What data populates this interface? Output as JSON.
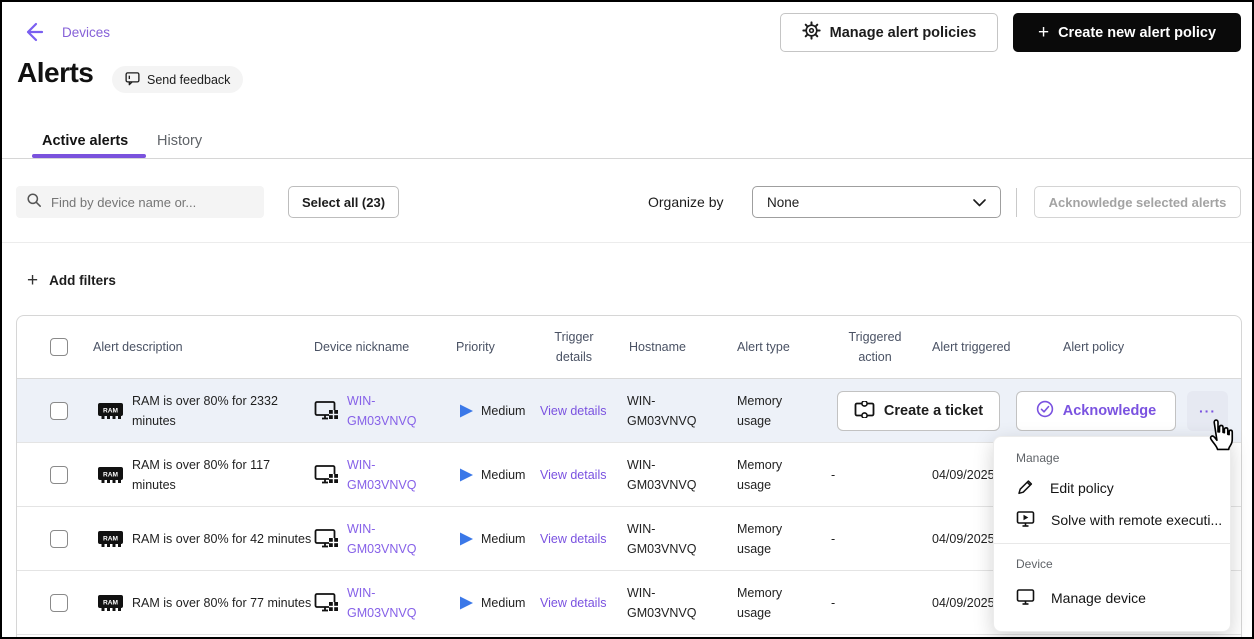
{
  "topbar": {
    "breadcrumb": "Devices",
    "manage_alert_policies": "Manage alert policies",
    "create_new_alert_policy": "Create new alert policy",
    "plus_glyph": "+"
  },
  "page": {
    "title": "Alerts",
    "send_feedback": "Send feedback"
  },
  "tabs": {
    "active_alerts": "Active alerts",
    "history": "History"
  },
  "toolbar": {
    "search_placeholder": "Find by device name or...",
    "select_all": "Select all (23)",
    "organize_by_label": "Organize by",
    "organize_by_value": "None",
    "acknowledge_selected": "Acknowledge selected alerts"
  },
  "filters": {
    "add_filters": "Add filters",
    "plus_glyph": "+"
  },
  "table": {
    "headers": {
      "alert_description": "Alert description",
      "device_nickname": "Device nickname",
      "priority": "Priority",
      "trigger_details": "Trigger details",
      "hostname": "Hostname",
      "alert_type": "Alert type",
      "triggered_action": "Triggered action",
      "alert_triggered": "Alert triggered",
      "alert_policy": "Alert policy"
    },
    "rows": [
      {
        "description": "RAM is over 80% for 2332 minutes",
        "nickname": "WIN-GM03VNVQ",
        "priority": "Medium",
        "trigger_details": "View details",
        "hostname": "WIN-GM03VNVQ",
        "alert_type": "Memory usage",
        "create_ticket": "Create a ticket",
        "acknowledge": "Acknowledge",
        "more_glyph": "···"
      },
      {
        "description": "RAM is over 80% for 117 minutes",
        "nickname": "WIN-GM03VNVQ",
        "priority": "Medium",
        "trigger_details": "View details",
        "hostname": "WIN-GM03VNVQ",
        "alert_type": "Memory usage",
        "triggered_action": "-",
        "alert_triggered": "04/09/2025"
      },
      {
        "description": "RAM is over 80% for 42 minutes",
        "nickname": "WIN-GM03VNVQ",
        "priority": "Medium",
        "trigger_details": "View details",
        "hostname": "WIN-GM03VNVQ",
        "alert_type": "Memory usage",
        "triggered_action": "-",
        "alert_triggered": "04/09/2025"
      },
      {
        "description": "RAM is over 80% for 77 minutes",
        "nickname": "WIN-GM03VNVQ",
        "priority": "Medium",
        "trigger_details": "View details",
        "hostname": "WIN-GM03VNVQ",
        "alert_type": "Memory usage",
        "triggered_action": "-",
        "alert_triggered": "04/09/2025"
      }
    ]
  },
  "context_menu": {
    "manage_section": "Manage",
    "edit_policy": "Edit policy",
    "solve_remote": "Solve with remote executi...",
    "device_section": "Device",
    "manage_device": "Manage device"
  },
  "icons": {
    "ram_label": "RAM"
  },
  "colors": {
    "accent_purple": "#7a52dd",
    "link_purple": "#8661e8",
    "priority_blue": "#3b78e8",
    "row_highlight": "#edf1f8",
    "create_button_bg": "#0a0a0a"
  }
}
